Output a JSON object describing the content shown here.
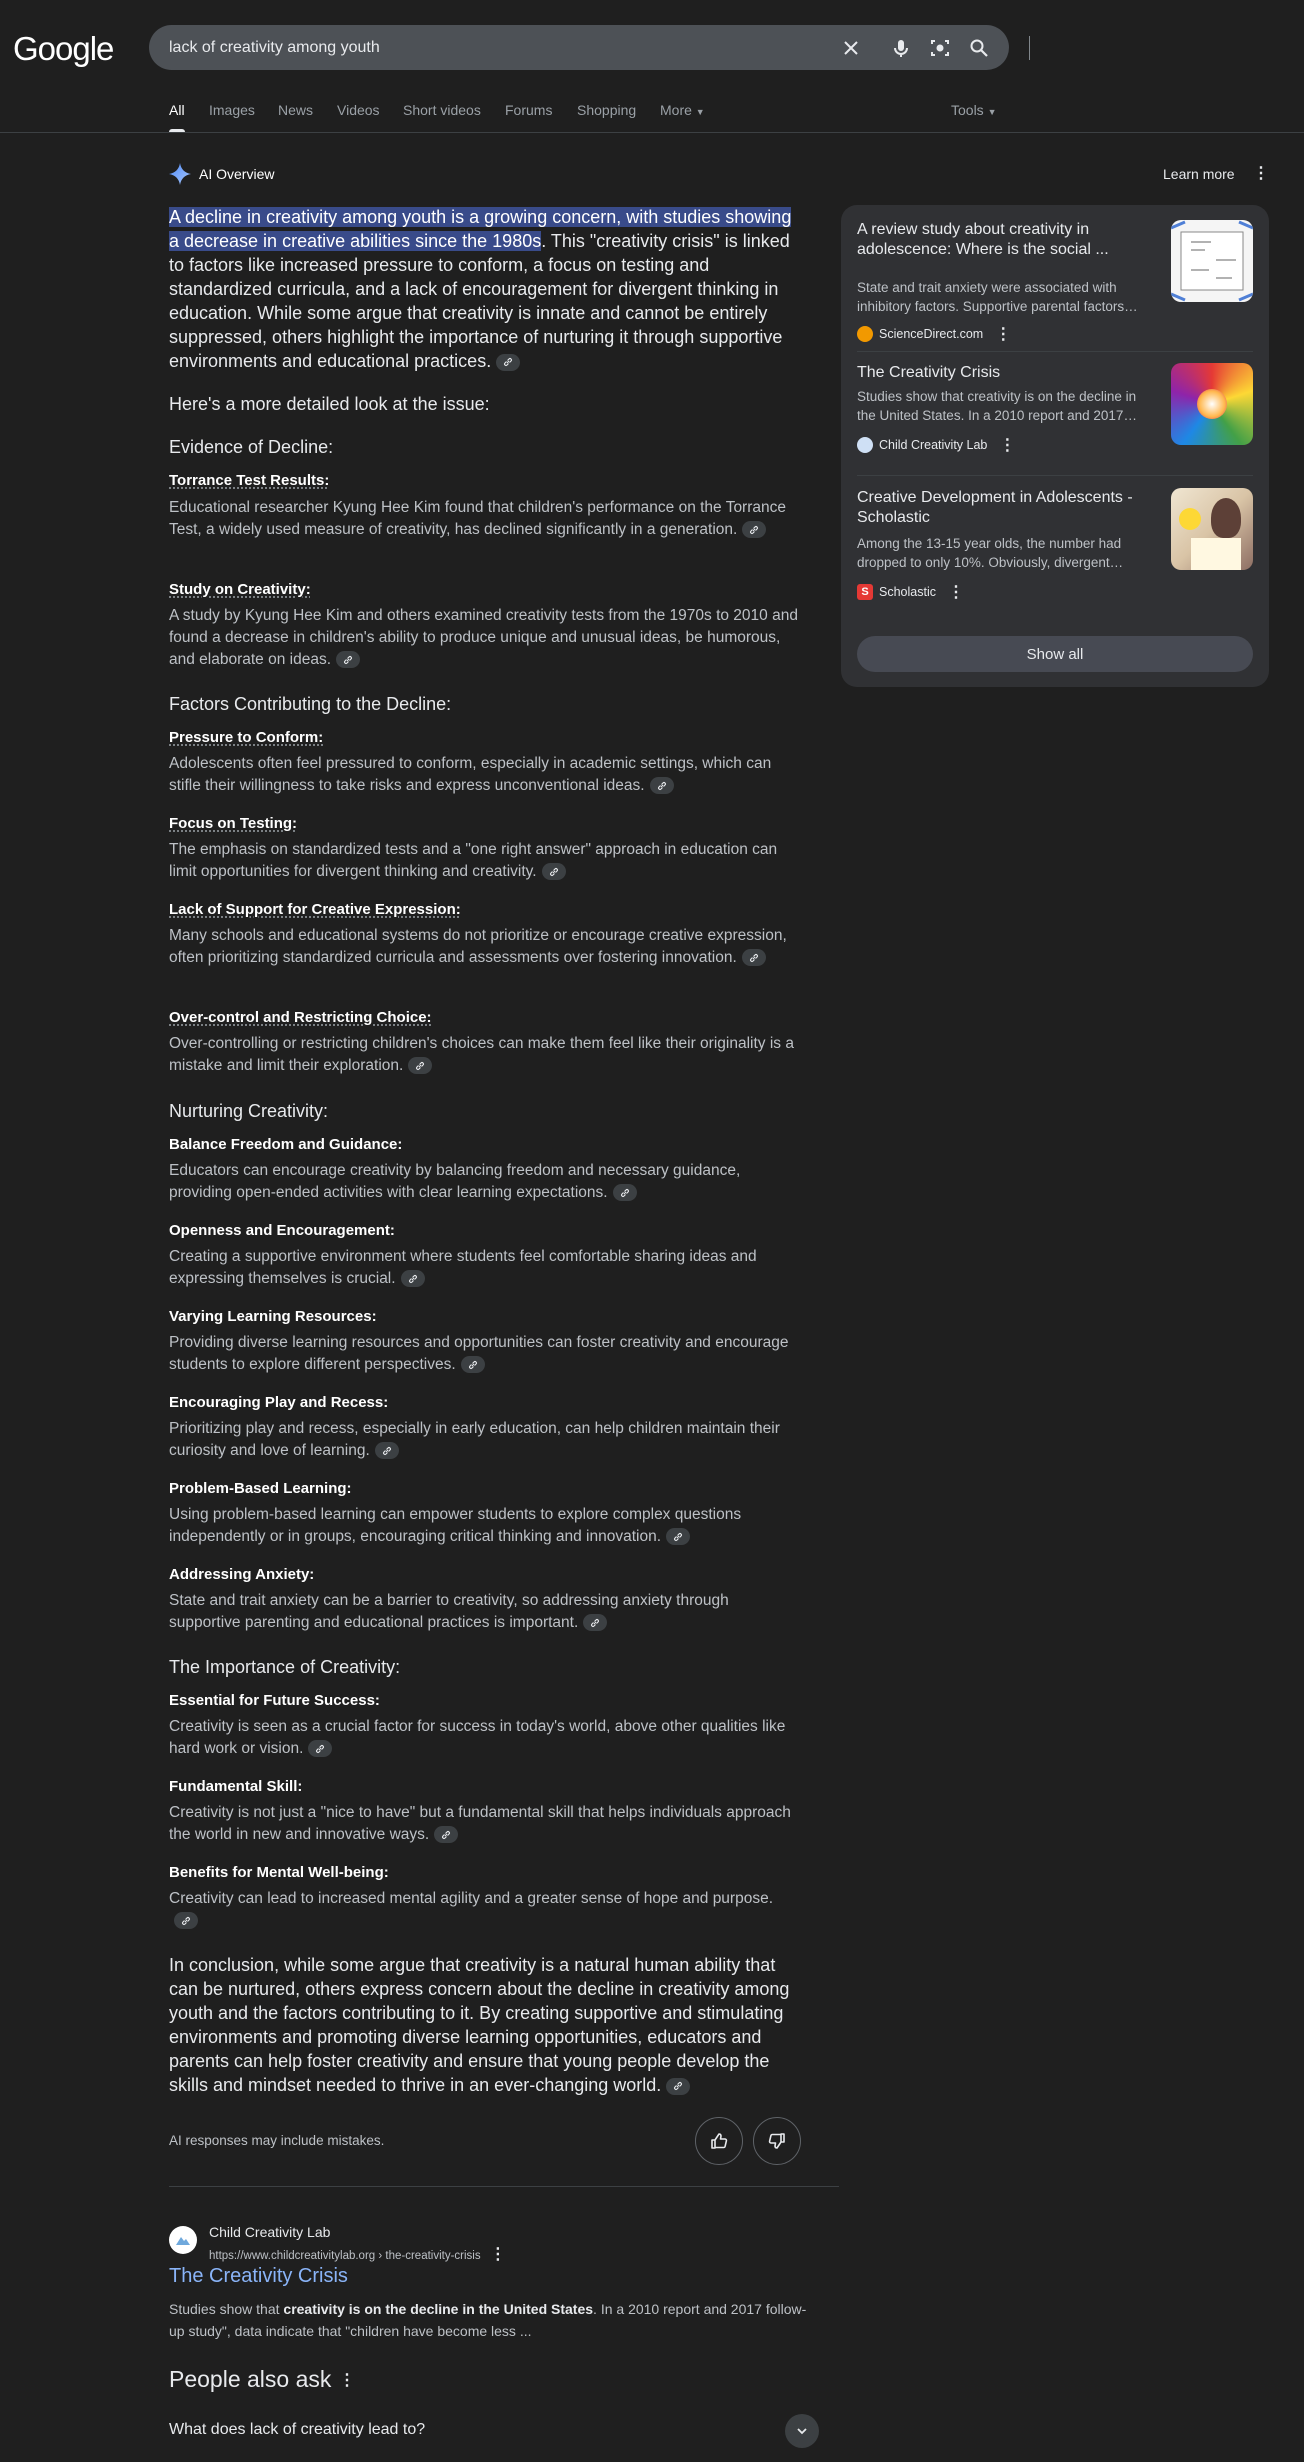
{
  "header": {
    "logo": "Google",
    "search_value": "lack of creativity among youth",
    "tabs": [
      "All",
      "Images",
      "News",
      "Videos",
      "Short videos",
      "Forums",
      "Shopping",
      "More"
    ],
    "tools": "Tools"
  },
  "overview": {
    "title": "AI Overview",
    "learn_more": "Learn more",
    "intro_highlight": "A decline in creativity among youth is a growing concern, with studies showing a decrease in creative abilities since the 1980s",
    "intro_rest": ". This \"creativity crisis\" is linked to factors like increased pressure to conform, a focus on testing and standardized curricula, and a lack of encouragement for divergent thinking in education. While some argue that creativity is innate and cannot be entirely suppressed, others highlight the importance of nurturing it through supportive environments and educational practices.",
    "detailed": "Here's a more detailed look at the issue:",
    "sections": [
      {
        "heading": "Evidence of Decline:",
        "items": [
          {
            "title": "Torrance Test Results:",
            "body": "Educational researcher Kyung Hee Kim found that children's performance on the Torrance Test, a widely used measure of creativity, has declined significantly in a generation."
          },
          {
            "title": "Study on Creativity:",
            "body": "A study by Kyung Hee Kim and others examined creativity tests from the 1970s to 2010 and found a decrease in children's ability to produce unique and unusual ideas, be humorous, and elaborate on ideas."
          }
        ]
      },
      {
        "heading": "Factors Contributing to the Decline:",
        "items": [
          {
            "title": "Pressure to Conform:",
            "body": "Adolescents often feel pressured to conform, especially in academic settings, which can stifle their willingness to take risks and express unconventional ideas."
          },
          {
            "title": "Focus on Testing:",
            "body": "The emphasis on standardized tests and a \"one right answer\" approach in education can limit opportunities for divergent thinking and creativity."
          },
          {
            "title": "Lack of Support for Creative Expression:",
            "body": "Many schools and educational systems do not prioritize or encourage creative expression, often prioritizing standardized curricula and assessments over fostering innovation."
          },
          {
            "title": "Over-control and Restricting Choice:",
            "body": "Over-controlling or restricting children's choices can make them feel like their originality is a mistake and limit their exploration."
          }
        ]
      },
      {
        "heading": "Nurturing Creativity:",
        "items": [
          {
            "title": "Balance Freedom and Guidance:",
            "body": "Educators can encourage creativity by balancing freedom and necessary guidance, providing open-ended activities with clear learning expectations."
          },
          {
            "title": "Openness and Encouragement:",
            "body": "Creating a supportive environment where students feel comfortable sharing ideas and expressing themselves is crucial."
          },
          {
            "title": "Varying Learning Resources:",
            "body": "Providing diverse learning resources and opportunities can foster creativity and encourage students to explore different perspectives."
          },
          {
            "title": "Encouraging Play and Recess:",
            "body": "Prioritizing play and recess, especially in early education, can help children maintain their curiosity and love of learning."
          },
          {
            "title": "Problem-Based Learning:",
            "body": "Using problem-based learning can empower students to explore complex questions independently or in groups, encouraging critical thinking and innovation."
          },
          {
            "title": "Addressing Anxiety:",
            "body": "State and trait anxiety can be a barrier to creativity, so addressing anxiety through supportive parenting and educational practices is important."
          }
        ]
      },
      {
        "heading": "The Importance of Creativity:",
        "items": [
          {
            "title": "Essential for Future Success:",
            "body": "Creativity is seen as a crucial factor for success in today's world, above other qualities like hard work or vision."
          },
          {
            "title": "Fundamental Skill:",
            "body": "Creativity is not just a \"nice to have\" but a fundamental skill that helps individuals approach the world in new and innovative ways."
          },
          {
            "title": "Benefits for Mental Well-being:",
            "body": "Creativity can lead to increased mental agility and a greater sense of hope and purpose."
          }
        ]
      }
    ],
    "conclusion": "In conclusion, while some argue that creativity is a natural human ability that can be nurtured, others express concern about the decline in creativity among youth and the factors contributing to it. By creating supportive and stimulating environments and promoting diverse learning opportunities, educators and parents can help foster creativity and ensure that young people develop the skills and mindset needed to thrive in an ever-changing world.",
    "disclaimer": "AI responses may include mistakes."
  },
  "sources": {
    "cards": [
      {
        "title": "A review study about creativity in adolescence: Where is the social ...",
        "desc": "State and trait anxiety were associated with inhibitory factors. Supportive parental factors…",
        "site": "ScienceDirect.com"
      },
      {
        "title": "The Creativity Crisis",
        "desc": "Studies show that creativity is on the decline in the United States. In a 2010 report and 2017…",
        "site": "Child Creativity Lab"
      },
      {
        "title": "Creative Development in Adolescents - Scholastic",
        "desc": "Among the 13-15 year olds, the number had dropped to only 10%. Obviously, divergent…",
        "site": "Scholastic"
      }
    ],
    "show_all": "Show all"
  },
  "result": {
    "site": "Child Creativity Lab",
    "url": "https://www.childcreativitylab.org › the-creativity-crisis",
    "title": "The Creativity Crisis",
    "snip_a": "Studies show that ",
    "snip_b": "creativity is on the decline in the United States",
    "snip_c": ". In a 2010 report and 2017 follow-up study\", data indicate that \"children have become less ..."
  },
  "paa": {
    "title": "People also ask",
    "q1": "What does lack of creativity lead to?"
  }
}
